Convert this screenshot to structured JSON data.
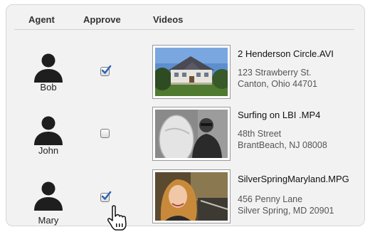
{
  "headers": {
    "agent": "Agent",
    "approve": "Approve",
    "videos": "Videos"
  },
  "rows": [
    {
      "agent": "Bob",
      "approved": true,
      "video_title": "2 Henderson Circle.AVI",
      "address_line1": "123 Strawberry St.",
      "address_line2": "Canton, Ohio 44701"
    },
    {
      "agent": "John",
      "approved": false,
      "video_title": "Surfing on LBI .MP4",
      "address_line1": "48th Street",
      "address_line2": "BrantBeach, NJ 08008"
    },
    {
      "agent": "Mary",
      "approved": true,
      "video_title": "SilverSpringMaryland.MPG",
      "address_line1": "456 Penny Lane",
      "address_line2": "Silver Spring, MD 20901"
    }
  ],
  "icons": {
    "avatar": "person-silhouette-icon",
    "cursor": "hand-pointer-icon",
    "check": "checkmark-icon"
  },
  "colors": {
    "check": "#2f63b8",
    "panel": "#f2f2f2",
    "avatar": "#1e1e1e"
  }
}
